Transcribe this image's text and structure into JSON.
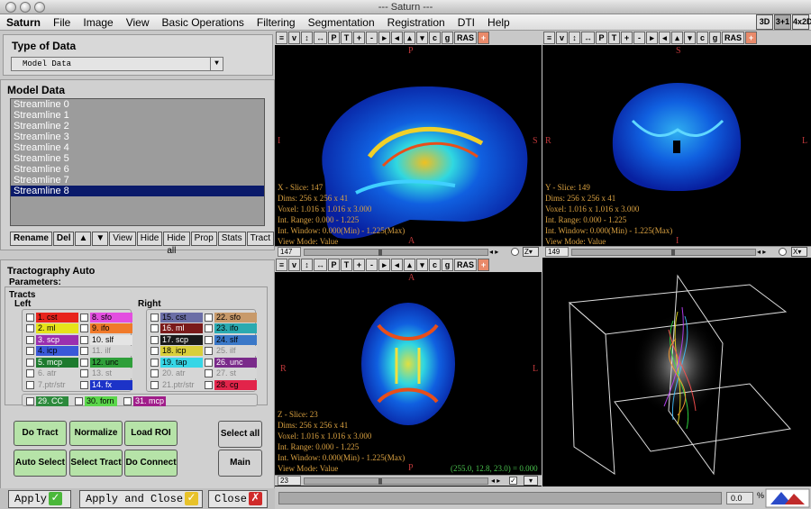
{
  "window": {
    "title": "--- Saturn ---"
  },
  "menu": [
    "Saturn",
    "File",
    "Image",
    "View",
    "Basic Operations",
    "Filtering",
    "Segmentation",
    "Registration",
    "DTI",
    "Help"
  ],
  "view_buttons": [
    "3D",
    "3+1",
    "4x2D"
  ],
  "type_of_data": {
    "title": "Type of Data",
    "selected": "Model Data"
  },
  "model_data": {
    "title": "Model Data",
    "items": [
      "Streamline 0",
      "Streamline 1",
      "Streamline 2",
      "Streamline 3",
      "Streamline 4",
      "Streamline 5",
      "Streamline 6",
      "Streamline 7",
      "Streamline 8"
    ],
    "selected_index": 8,
    "buttons": [
      "Rename",
      "Del",
      "▲",
      "▼",
      "View",
      "Hide",
      "Hide all",
      "Prop",
      "Stats",
      "Tract"
    ]
  },
  "tracto": {
    "title": "Tractography Auto",
    "params_label": "Parameters:",
    "tracts_label": "Tracts",
    "left_label": "Left",
    "right_label": "Right",
    "left_col1": [
      {
        "label": "1. cst",
        "color": "#e8241c"
      },
      {
        "label": "2. ml",
        "color": "#e6e21a"
      },
      {
        "label": "3. scp",
        "color": "#9b2fb0"
      },
      {
        "label": "4. icp",
        "color": "#3a58d8"
      },
      {
        "label": "5. mcp",
        "color": "#1d7a2e"
      },
      {
        "label": "6. atr",
        "color": "#d6d6d6"
      },
      {
        "label": "7.ptr/str",
        "color": "#d6d6d6"
      }
    ],
    "left_col2": [
      {
        "label": "8. sfo",
        "color": "#e34ee0"
      },
      {
        "label": "9. ifo",
        "color": "#f07a2a"
      },
      {
        "label": "10. slf",
        "color": "#e4e4e4"
      },
      {
        "label": "11. ilf",
        "color": "#d6d6d6"
      },
      {
        "label": "12. unc",
        "color": "#2f9f3a"
      },
      {
        "label": "13. st",
        "color": "#d6d6d6"
      },
      {
        "label": "14. fx",
        "color": "#1c33c8"
      }
    ],
    "right_col1": [
      {
        "label": "15. cst",
        "color": "#6b6ea6"
      },
      {
        "label": "16. ml",
        "color": "#7a1a1a"
      },
      {
        "label": "17. scp",
        "color": "#1a1a1a"
      },
      {
        "label": "18. icp",
        "color": "#d9cf3a"
      },
      {
        "label": "19. tap",
        "color": "#36d6e6"
      },
      {
        "label": "20. atr",
        "color": "#d6d6d6"
      },
      {
        "label": "21.ptr/str",
        "color": "#d6d6d6"
      }
    ],
    "right_col2": [
      {
        "label": "22. sfo",
        "color": "#c89a6a"
      },
      {
        "label": "23. ifo",
        "color": "#2aaab0"
      },
      {
        "label": "24. slf",
        "color": "#3a78c8"
      },
      {
        "label": "25. ilf",
        "color": "#d6d6d6"
      },
      {
        "label": "26. unc",
        "color": "#7a2a8a"
      },
      {
        "label": "27. st",
        "color": "#d6d6d6"
      },
      {
        "label": "28. cg",
        "color": "#e2244a"
      }
    ],
    "bottom_row": [
      {
        "label": "29. CC",
        "color": "#2c8a3c"
      },
      {
        "label": "30. forn",
        "color": "#5ad64a"
      },
      {
        "label": "31. mcp",
        "color": "#a01e8a"
      }
    ],
    "buttons": {
      "do_tract": "Do Tract",
      "normalize": "Normalize",
      "load_roi": "Load ROI",
      "auto_select": "Auto Select",
      "select_tract": "Select Tract",
      "do_connect": "Do Connect",
      "select_all": "Select all",
      "main": "Main"
    }
  },
  "footer": {
    "apply": "Apply",
    "apply_close": "Apply and Close",
    "close": "Close"
  },
  "view_toolbar": [
    "≡",
    "v",
    "↕",
    "↔",
    "P",
    "T",
    "+",
    "-",
    "▸",
    "◂",
    "▴",
    "▾",
    "c",
    "g",
    "RAS",
    "+"
  ],
  "views": {
    "sagittal": {
      "orient_top": "P",
      "orient_left": "I",
      "orient_right": "S",
      "orient_bottom": "A",
      "info": [
        "X - Slice: 147",
        "Dims: 256 x 256 x 41",
        "Voxel: 1.016 x 1.016 x 3.000",
        "Int. Range: 0.000 - 1.225",
        "Int. Window: 0.000(Min) - 1.225(Max)",
        "View Mode: Value"
      ],
      "slice_num": "147",
      "axis_sel": "Z",
      "thumb_frac": 0.41
    },
    "coronal": {
      "orient_top": "S",
      "orient_left": "R",
      "orient_right": "L",
      "orient_bottom": "I",
      "info": [
        "Y - Slice: 149",
        "Dims: 256 x 256 x 41",
        "Voxel: 1.016 x 1.016 x 3.000",
        "Int. Range: 0.000 - 1.225",
        "Int. Window: 0.000(Min) - 1.225(Max)",
        "View Mode: Value"
      ],
      "slice_num": "149",
      "axis_sel": "X",
      "thumb_frac": 0.55
    },
    "axial": {
      "orient_top": "A",
      "orient_left": "R",
      "orient_right": "L",
      "orient_bottom": "P",
      "info": [
        "Z - Slice: 23",
        "Dims: 256 x 256 x 41",
        "Voxel: 1.016 x 1.016 x 3.000",
        "Int. Range: 0.000 - 1.225",
        "Int. Window: 0.000(Min) - 1.225(Max)",
        "View Mode: Value"
      ],
      "coord": "(255.0, 12.8, 23.0) = 0.000",
      "slice_num": "23",
      "thumb_frac": 0.41
    }
  },
  "status": {
    "value": "0.0"
  }
}
